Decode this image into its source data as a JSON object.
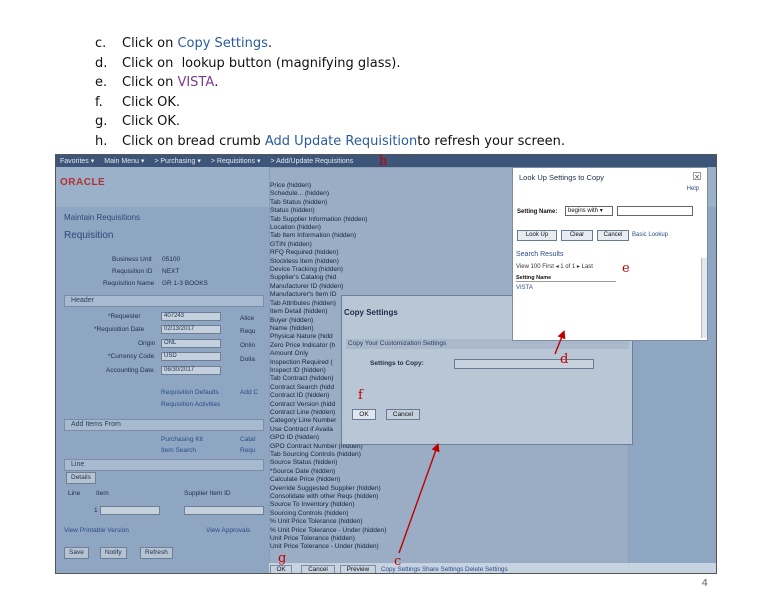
{
  "steps": [
    {
      "letter": "c.",
      "pre": "Click on ",
      "hl": "Copy Settings",
      "post": "."
    },
    {
      "letter": "d.",
      "pre": "Click on  lookup button (magnifying glass).",
      "hl": "",
      "post": ""
    },
    {
      "letter": "e.",
      "pre": "Click on ",
      "hl": "VISTA",
      "post": "."
    },
    {
      "letter": "f.",
      "pre": "Click OK.",
      "hl": "",
      "post": ""
    },
    {
      "letter": "g.",
      "pre": "Click OK.",
      "hl": "",
      "post": ""
    },
    {
      "letter": "h.",
      "pre": "Click on bread crumb ",
      "hl": "Add Update Requisition",
      "post": " to refresh your screen."
    }
  ],
  "menubar": [
    "Favorites ▾",
    "Main Menu ▾",
    "> Purchasing ▾",
    "> Requisitions ▾",
    "> Add/Update Requisitions"
  ],
  "oracle": "ORACLE",
  "maintain": "Maintain Requisitions",
  "requisition": "Requisition",
  "fields": {
    "business_unit_lbl": "Business Unit",
    "business_unit": "05100",
    "requisition_id_lbl": "Requisition ID",
    "requisition_id": "NEXT",
    "requisition_name_lbl": "Requisition Name",
    "requisition_name": "GR 1-3 BOOKS",
    "header": "Header",
    "requester_lbl": "*Requester",
    "requester": "407243",
    "req_date_lbl": "*Requisition Date",
    "req_date": "02/13/2017",
    "origin_lbl": "Origin",
    "origin": "ONL",
    "currency_lbl": "*Currency Code",
    "currency": "USD",
    "acct_date_lbl": "Accounting Date",
    "acct_date": "06/30/2017",
    "alice": "Alice",
    "requ": "Requ",
    "onlin": "Onlin",
    "dolla": "Dolla",
    "req_defaults": "Requisition Defaults",
    "add_c": "Add C",
    "req_activities": "Requisition Activities",
    "add_items": "Add Items From",
    "purchasing_kit": "Purchasing Kit",
    "catal": "Catal",
    "item_search": "Item Search",
    "requ2": "Requ",
    "line": "Line",
    "details": "Details",
    "col_line": "Line",
    "col_item": "Item",
    "col_supplier": "Supplier Item ID",
    "line_num": "1",
    "view_printable": "View Printable Version",
    "view_approvals": "View Approvals",
    "save": "Save",
    "notify": "Notify",
    "refresh": "Refresh"
  },
  "list_items": [
    "Price (hidden)",
    "Schedule... (hidden)",
    "Tab Status (hidden)",
    "Status (hidden)",
    "Tab Supplier Information (hidden)",
    "Location (hidden)",
    "Tab Item Information (hidden)",
    "GTIN (hidden)",
    "RFQ Required (hidden)",
    "Stockless Item (hidden)",
    "Device Tracking (hidden)",
    "Supplier's Catalog (hid",
    "Manufacturer ID (hidden)",
    "Manufacturer's Item ID",
    "Tab Attributes (hidden)",
    "Item Detail (hidden)",
    "Buyer (hidden)",
    "Name (hidden)",
    "Physical Nature (hidd",
    "Zero Price Indicator (h",
    "Amount Only",
    "Inspection Required (",
    "Inspect ID (hidden)",
    "Tab Contract (hidden)",
    "Contract Search (hidd",
    "Contract ID (hidden)",
    "Contract Version (hidd",
    "Contract Line (hidden)",
    "Category Line Number",
    "Use Contract if Availa",
    "GPO ID (hidden)",
    "GPO Contract Number (hidden)",
    "Tab Sourcing Controls (hidden)",
    "Source Status (hidden)",
    "*Source Date (hidden)",
    "Calculate Price (hidden)",
    "Override Suggested Supplier (hidden)",
    "Consolidate with other Reqs (hidden)",
    "Source To Inventory (hidden)",
    "Sourcing Controls (hidden)",
    "% Unit Price Tolerance (hidden)",
    "% Unit Price Tolerance - Under (hidden)",
    "Unit Price Tolerance (hidden)",
    "Unit Price Tolerance - Under (hidden)"
  ],
  "copy_dialog": {
    "title": "Copy Settings",
    "band": "Copy Your Customization Settings",
    "settings_to_copy": "Settings to Copy:",
    "ok": "OK",
    "cancel": "Cancel"
  },
  "lookup": {
    "title": "Look Up Settings to Copy",
    "help": "Help",
    "close": "×",
    "setting_name_lbl": "Setting Name:",
    "combo": "begins with",
    "lookup_btn": "Look Up",
    "clear_btn": "Clear",
    "cancel_btn": "Cancel",
    "basic": "Basic Lookup",
    "search_results": "Search Results",
    "pager": "View 100   First  ◂  1 of 1  ▸  Last",
    "col_header": "Setting Name",
    "vista": "VISTA"
  },
  "bottom": {
    "ok": "OK",
    "cancel": "Cancel",
    "preview": "Preview",
    "links": "Copy Settings  Share Settings  Delete Settings"
  },
  "annotations": {
    "h": "h",
    "e": "e",
    "d": "d",
    "f": "f",
    "g": "g",
    "c": "c"
  },
  "page_number": "4",
  "colors": {
    "annotation": "#c00000",
    "link": "#2a5b9e"
  }
}
